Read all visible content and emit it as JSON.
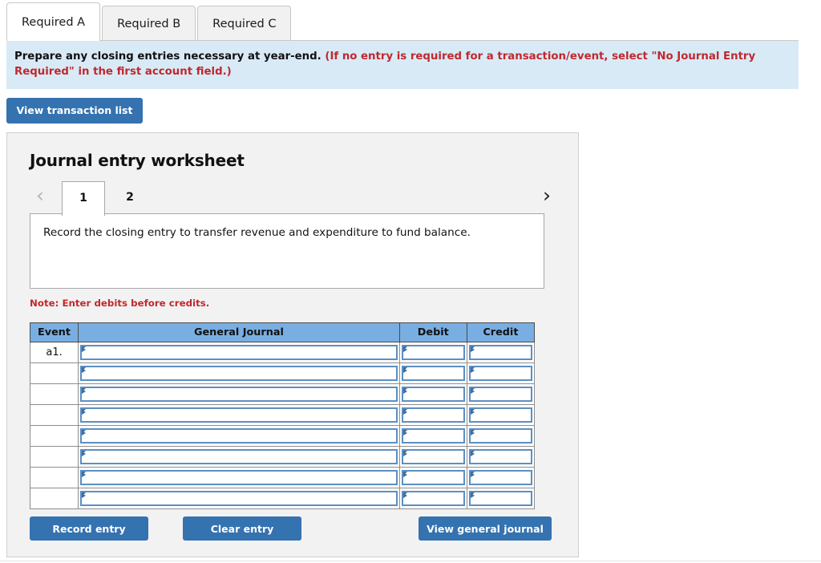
{
  "requirement_tabs": [
    {
      "label": "Required A",
      "active": true
    },
    {
      "label": "Required B",
      "active": false
    },
    {
      "label": "Required C",
      "active": false
    }
  ],
  "banner": {
    "main_text": "Prepare any closing entries necessary at year-end.",
    "hint_text": "(If no entry is required for a transaction/event, select \"No Journal Entry Required\" in the first account field.)"
  },
  "toolbar": {
    "view_transaction_list_label": "View transaction list"
  },
  "worksheet": {
    "title": "Journal entry worksheet",
    "prev_icon": "chevron-left-icon",
    "next_icon": "chevron-right-icon",
    "prev_enabled": false,
    "next_enabled": true,
    "page_tabs": [
      {
        "label": "1",
        "active": true
      },
      {
        "label": "2",
        "active": false
      }
    ],
    "description": "Record the closing entry to transfer revenue and expenditure to fund balance.",
    "note": "Note: Enter debits before credits."
  },
  "journal_table": {
    "headers": [
      "Event",
      "General Journal",
      "Debit",
      "Credit"
    ],
    "rows": [
      {
        "event": "a1.",
        "general_journal": "",
        "debit": "",
        "credit": ""
      },
      {
        "event": "",
        "general_journal": "",
        "debit": "",
        "credit": ""
      },
      {
        "event": "",
        "general_journal": "",
        "debit": "",
        "credit": ""
      },
      {
        "event": "",
        "general_journal": "",
        "debit": "",
        "credit": ""
      },
      {
        "event": "",
        "general_journal": "",
        "debit": "",
        "credit": ""
      },
      {
        "event": "",
        "general_journal": "",
        "debit": "",
        "credit": ""
      },
      {
        "event": "",
        "general_journal": "",
        "debit": "",
        "credit": ""
      },
      {
        "event": "",
        "general_journal": "",
        "debit": "",
        "credit": ""
      }
    ]
  },
  "footer": {
    "record_entry_label": "Record entry",
    "clear_entry_label": "Clear entry",
    "view_general_journal_label": "View general journal"
  },
  "colors": {
    "button_blue": "#3572b0",
    "table_header_blue": "#79aee2",
    "banner_blue": "#d9eaf7",
    "alert_red": "#c0282d",
    "panel_gray": "#f2f2f2",
    "input_border_blue": "#5b8fc4"
  }
}
